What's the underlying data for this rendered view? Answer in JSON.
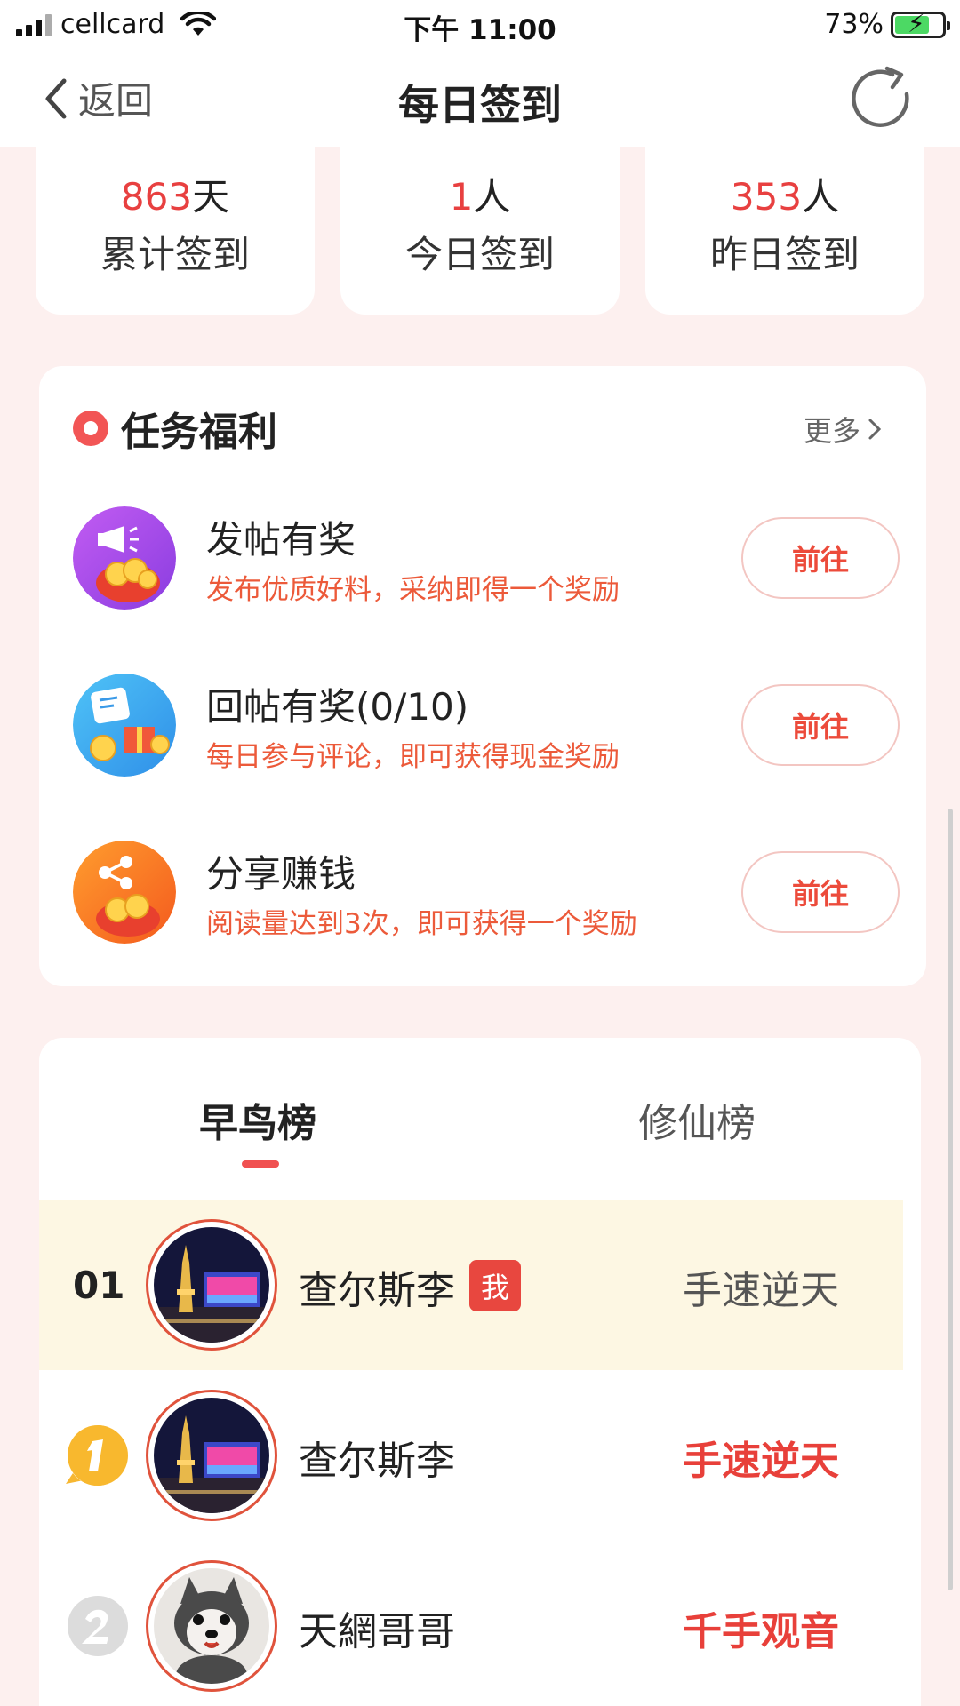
{
  "status_bar": {
    "carrier": "cellcard",
    "time": "下午 11:00",
    "battery": "73%",
    "battery_level": 0.73
  },
  "nav": {
    "back_label": "返回",
    "title": "每日签到",
    "refresh_icon": "refresh-icon"
  },
  "stats": [
    {
      "value": "863",
      "unit": "天",
      "label": "累计签到"
    },
    {
      "value": "1",
      "unit": "人",
      "label": "今日签到"
    },
    {
      "value": "353",
      "unit": "人",
      "label": "昨日签到"
    }
  ],
  "tasks": {
    "title": "任务福利",
    "more_label": "更多",
    "items": [
      {
        "title": "发帖有奖",
        "desc": "发布优质好料，采纳即得一个奖励",
        "button": "前往",
        "icon": "megaphone-coins-icon"
      },
      {
        "title": "回帖有奖(0/10)",
        "desc": "每日参与评论，即可获得现金奖励",
        "button": "前往",
        "icon": "comment-gift-icon"
      },
      {
        "title": "分享赚钱",
        "desc": "阅读量达到3次，即可获得一个奖励",
        "button": "前往",
        "icon": "share-coins-icon"
      }
    ]
  },
  "ranking": {
    "tabs": [
      "早鸟榜",
      "修仙榜"
    ],
    "active_tab": "早鸟榜",
    "me_badge": "我",
    "rows": [
      {
        "rank": "01",
        "name": "查尔斯李",
        "title": "手速逆天",
        "is_me": true,
        "avatar": "night-city-avatar"
      },
      {
        "rank": "1",
        "name": "查尔斯李",
        "title": "手速逆天",
        "is_me": false,
        "avatar": "night-city-avatar"
      },
      {
        "rank": "2",
        "name": "天網哥哥",
        "title": "千手观音",
        "is_me": false,
        "avatar": "husky-plush-avatar"
      }
    ]
  },
  "colors": {
    "accent_red": "#e8403a",
    "desc_orange": "#ec5a3a",
    "page_bg": "#fdf0ef",
    "me_row_bg": "#fdf7e3",
    "battery_green": "#4cd964"
  }
}
